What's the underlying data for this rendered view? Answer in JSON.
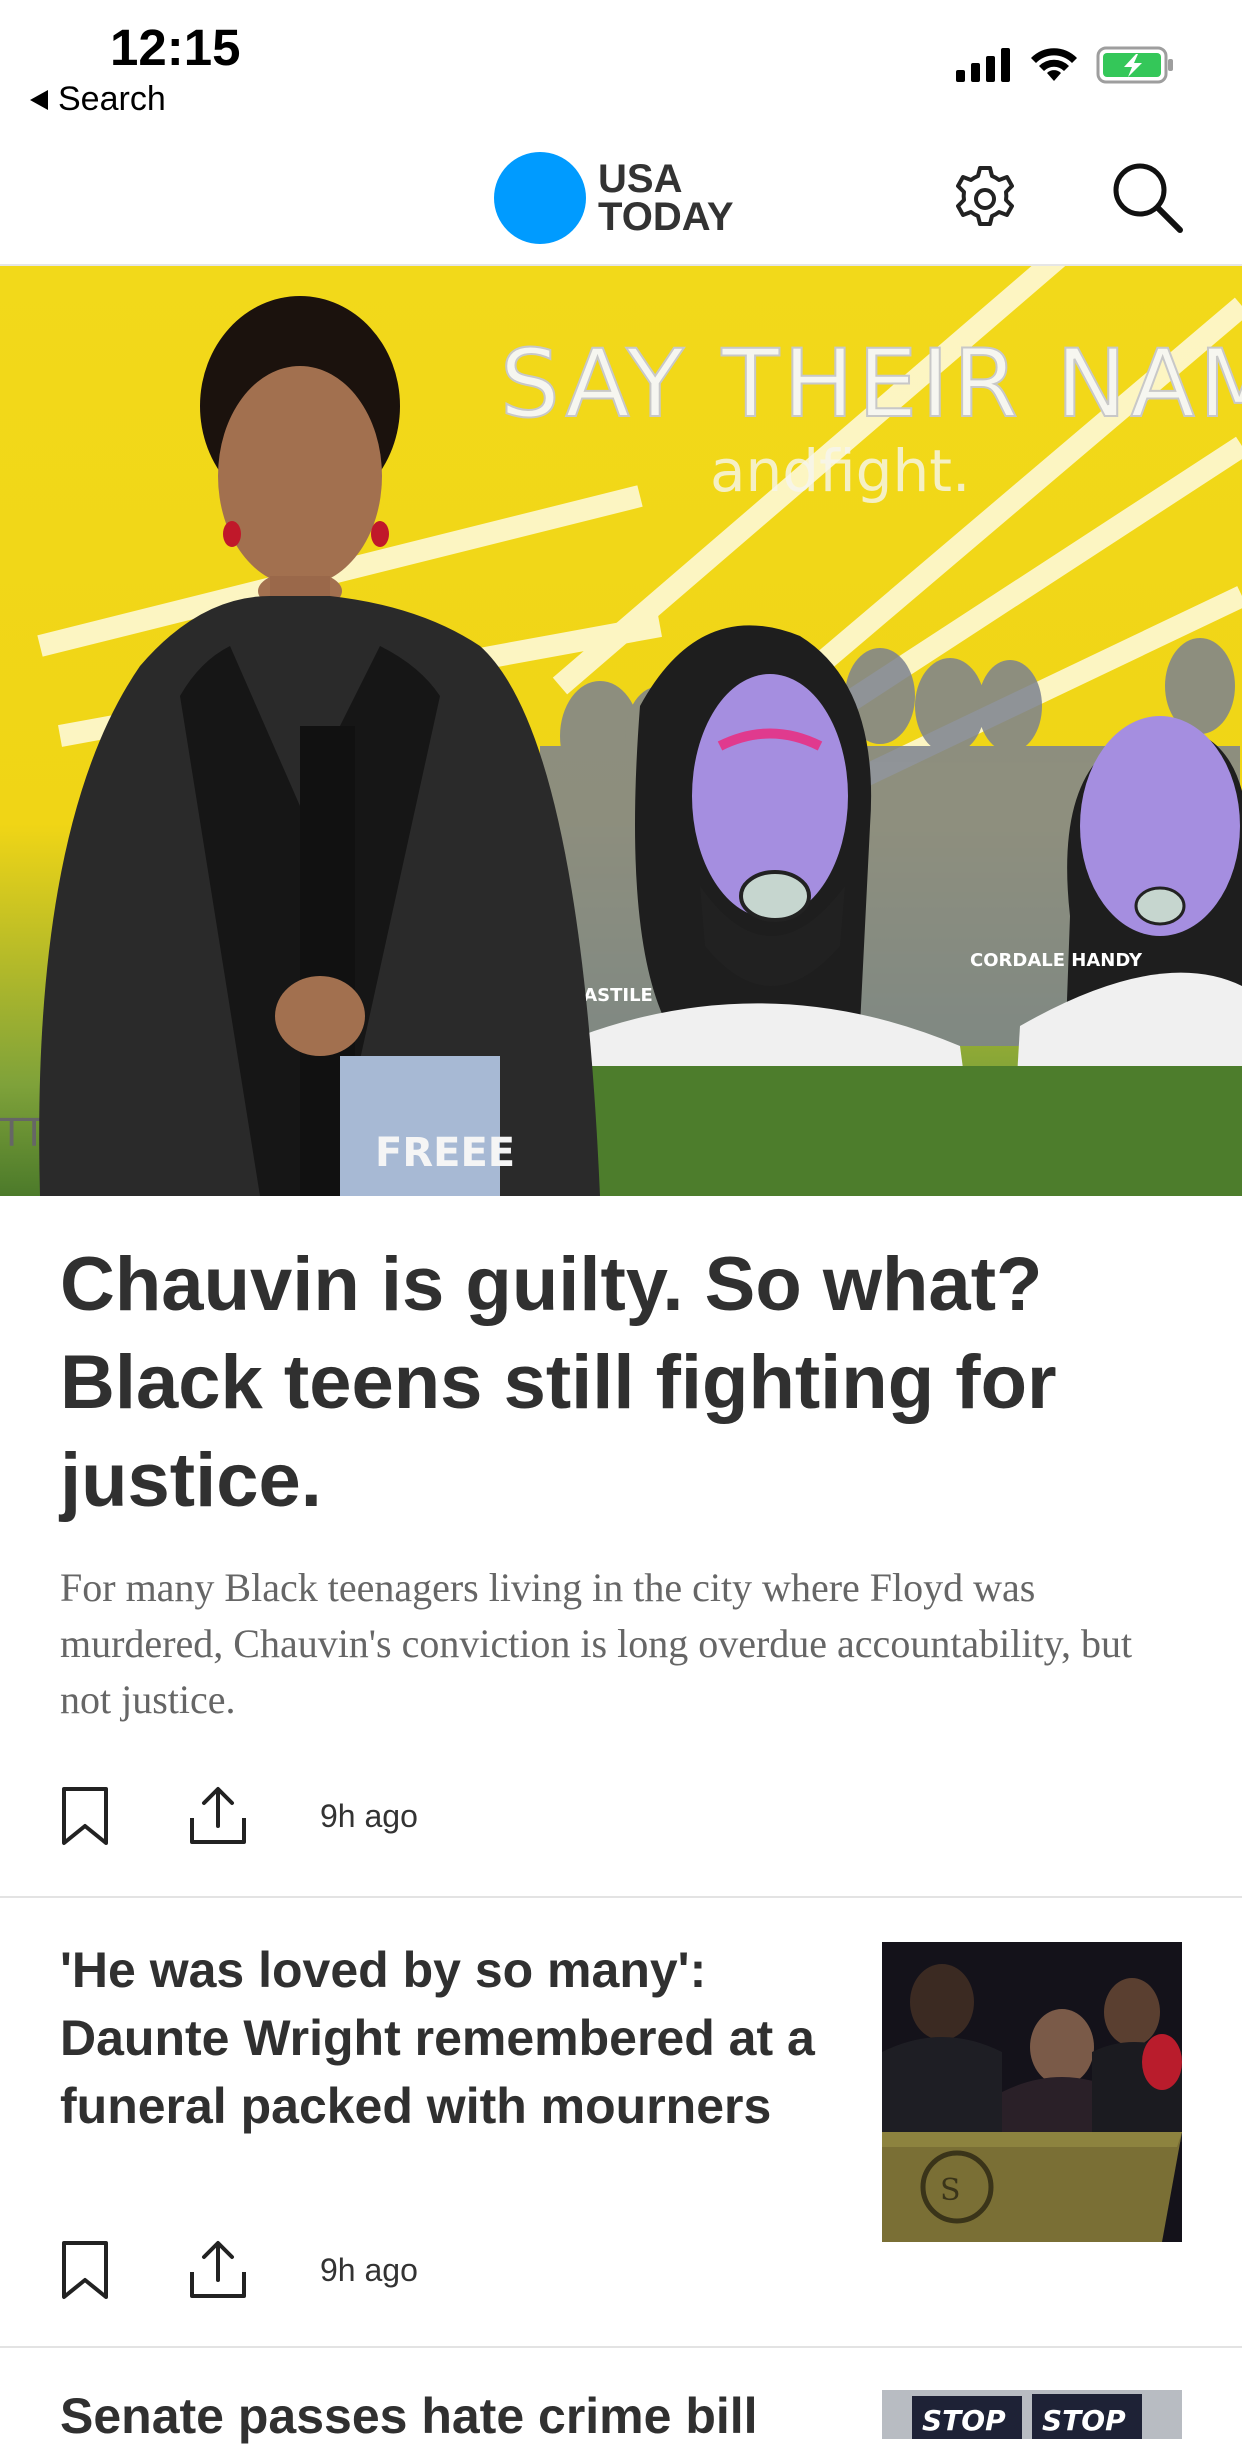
{
  "status": {
    "time": "12:15",
    "back_label": "Search"
  },
  "header": {
    "logo_line1": "USA",
    "logo_line2": "TODAY",
    "accent": "#009bff",
    "icons": [
      "gear-icon",
      "search-icon"
    ]
  },
  "hero": {
    "title": "Chauvin is guilty. So what? Black teens still fighting for justice.",
    "summary": "For many Black teenagers living in the city where Floyd was murdered, Chauvin's conviction is long overdue accountability, but not justice.",
    "time_ago": "9h ago",
    "image": {
      "mural_headline": "SAY THEIR NAMES",
      "mural_sub": "andfight.",
      "mural_name": "CORDALE HANDY",
      "mural_name2": "CASTILE",
      "jeans_text": "FREEE",
      "mural_left": "TTER"
    }
  },
  "stories": [
    {
      "title": "'He was loved by so many': Daunte Wright remembered at a funeral packed with mourners",
      "time_ago": "9h ago"
    },
    {
      "title": "Senate passes hate crime bill",
      "sign_text": "STOP"
    }
  ]
}
